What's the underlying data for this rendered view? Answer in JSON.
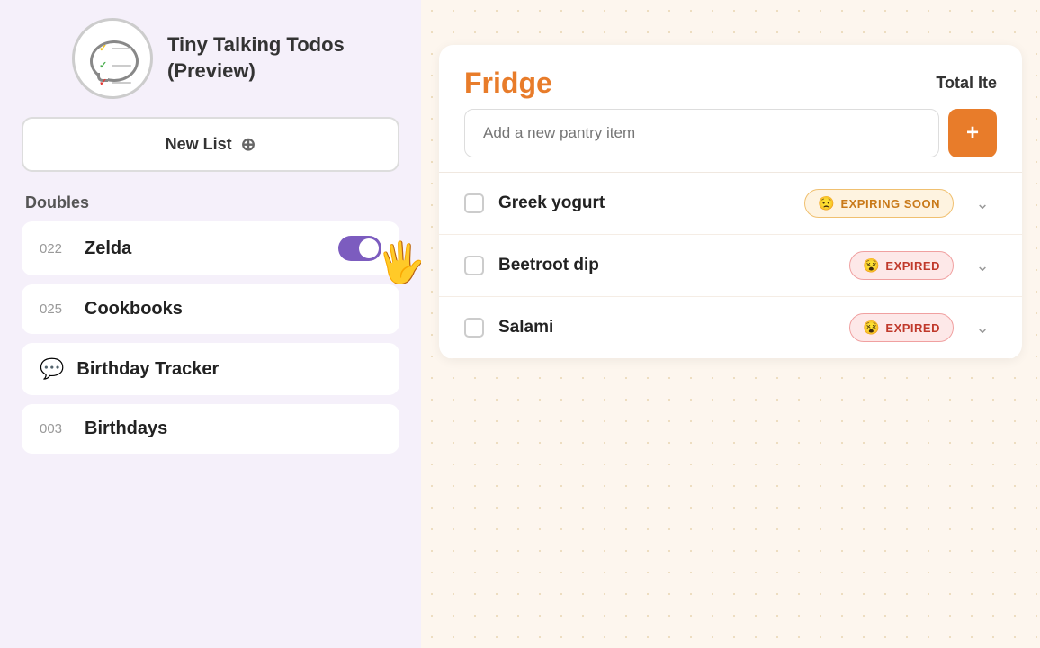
{
  "app": {
    "title": "Tiny Talking Todos (Preview)"
  },
  "sidebar": {
    "new_list_label": "New List",
    "sections": [
      {
        "label": "Doubles",
        "items": [
          {
            "id": "zelda",
            "number": "022",
            "name": "Zelda",
            "toggle": true
          }
        ]
      }
    ],
    "items_below": [
      {
        "id": "cookbooks",
        "number": "025",
        "name": "Cookbooks"
      },
      {
        "id": "birthday-tracker",
        "number": null,
        "name": "Birthday Tracker",
        "icon": "chat"
      },
      {
        "id": "birthdays",
        "number": "003",
        "name": "Birthdays"
      }
    ]
  },
  "main": {
    "section_title": "Fridge",
    "total_items_label": "Total Ite",
    "add_item_placeholder": "Add a new pantry item",
    "items": [
      {
        "id": "greek-yogurt",
        "name": "Greek yogurt",
        "status": "expiring_soon",
        "status_label": "EXPIRING SOON",
        "status_emoji": "😟"
      },
      {
        "id": "beetroot-dip",
        "name": "Beetroot dip",
        "status": "expired",
        "status_label": "EXPIRED",
        "status_emoji": "😵"
      },
      {
        "id": "salami",
        "name": "Salami",
        "status": "expired",
        "status_label": "EXPIRED",
        "status_emoji": "😵"
      }
    ]
  },
  "logo": {
    "checks": [
      {
        "color": "#f5c518"
      },
      {
        "color": "#4caf50"
      },
      {
        "color": "#e53935"
      }
    ]
  }
}
